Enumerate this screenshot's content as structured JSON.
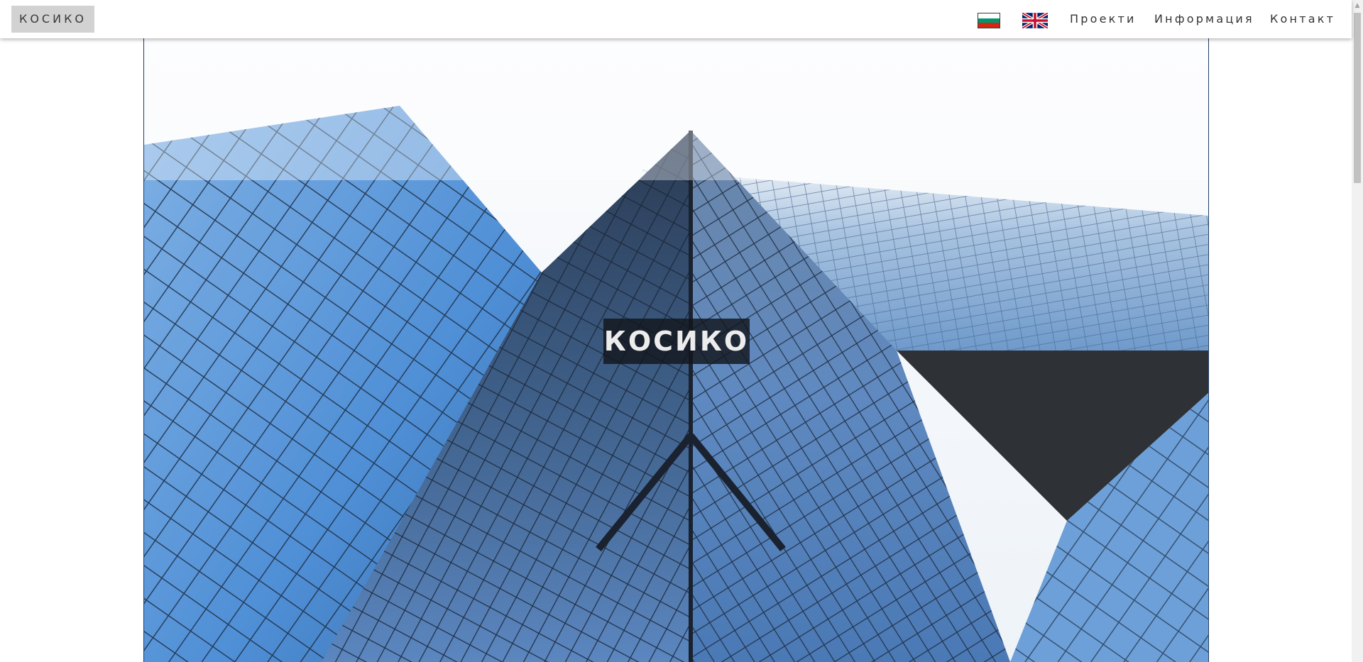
{
  "navbar": {
    "brand": "КОСИКО",
    "flags": [
      {
        "icon": "bulgarian-flag-icon",
        "colors": [
          "#ffffff",
          "#00966e",
          "#d62612"
        ]
      },
      {
        "icon": "uk-flag-icon",
        "colors": [
          "#012169",
          "#ffffff",
          "#c8102e"
        ]
      }
    ],
    "links": {
      "projects": "Проекти",
      "info": "Информация",
      "contact": "Контакт"
    }
  },
  "hero": {
    "title": "КОСИКО",
    "image": "skyscraper-glass-facade-photo"
  },
  "colors": {
    "brand_button_bg": "#d2d2d2",
    "hero_border": "#1f3d66",
    "title_bg": "#12161c"
  }
}
